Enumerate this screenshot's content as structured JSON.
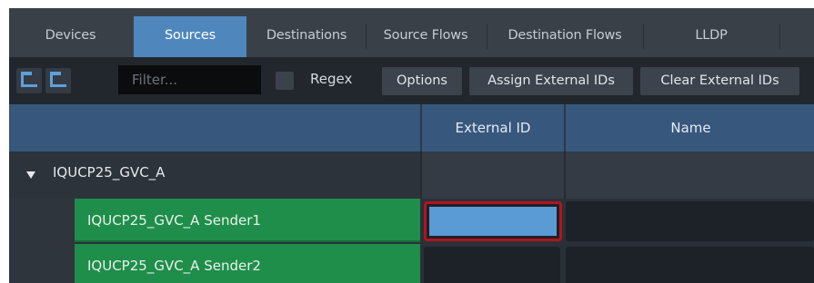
{
  "tabs": [
    {
      "label": "Devices",
      "active": false
    },
    {
      "label": "Sources",
      "active": true
    },
    {
      "label": "Destinations",
      "active": false
    },
    {
      "label": "Source Flows",
      "active": false
    },
    {
      "label": "Destination Flows",
      "active": false
    },
    {
      "label": "LLDP",
      "active": false
    }
  ],
  "toolbar": {
    "expand_icon": "expand-all-icon",
    "collapse_icon": "collapse-all-icon",
    "filter_placeholder": "Filter...",
    "filter_value": "",
    "regex_label": "Regex",
    "regex_checked": false,
    "options_label": "Options",
    "assign_label": "Assign External IDs",
    "clear_label": "Clear External IDs"
  },
  "table": {
    "headers": {
      "col0": "",
      "external_id": "External ID",
      "name": "Name"
    },
    "group": {
      "label": "IQUCP25_GVC_A",
      "expanded": true
    },
    "rows": [
      {
        "name": "IQUCP25_GVC_A Sender1",
        "external_id": "",
        "selected": true
      },
      {
        "name": "IQUCP25_GVC_A Sender2",
        "external_id": "",
        "selected": false
      }
    ]
  },
  "colors": {
    "active_tab": "#4f87bd",
    "sender_row": "#1f8e4b",
    "selection_border": "#b3141c",
    "header": "#37577d"
  }
}
